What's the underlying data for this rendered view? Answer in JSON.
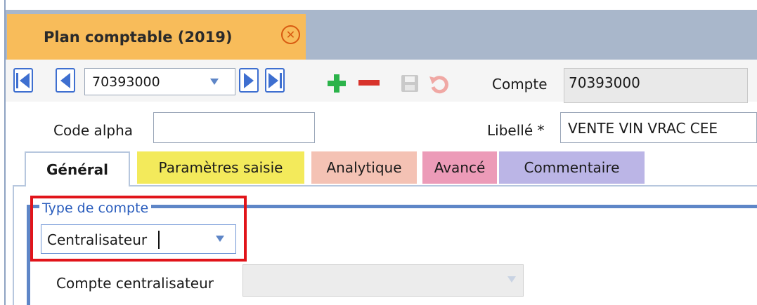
{
  "window": {
    "tab_title": "Plan comptable (2019)",
    "close_icon": "close-circle-icon"
  },
  "toolbar": {
    "account_selected": "70393000",
    "nav_icons": [
      "first-record-icon",
      "previous-record-icon",
      "next-record-icon",
      "last-record-icon"
    ],
    "action_icons": [
      "add-icon",
      "remove-icon",
      "save-icon",
      "undo-icon"
    ]
  },
  "form": {
    "compte_label": "Compte",
    "compte_value": "70393000",
    "code_alpha_label": "Code alpha",
    "code_alpha_value": "",
    "libelle_label": "Libellé *",
    "libelle_value": "VENTE VIN VRAC CEE"
  },
  "tabs": [
    {
      "label": "Général",
      "active": true,
      "color": "#ffffff"
    },
    {
      "label": "Paramètres saisie",
      "active": false,
      "color": "#f3ea5b"
    },
    {
      "label": "Analytique",
      "active": false,
      "color": "#f4c2b4"
    },
    {
      "label": "Avancé",
      "active": false,
      "color": "#ec9bb8"
    },
    {
      "label": "Commentaire",
      "active": false,
      "color": "#bbb5e6"
    }
  ],
  "general": {
    "group_title": "Type de compte",
    "type_value": "Centralisateur",
    "centralisateur_label": "Compte centralisateur",
    "centralisateur_value": ""
  },
  "colors": {
    "tab_active": "#f8bc5a",
    "accent_blue": "#3e6fd0",
    "highlight_red": "#e1141a",
    "add_green": "#2bb34a",
    "remove_red": "#d8332b"
  }
}
